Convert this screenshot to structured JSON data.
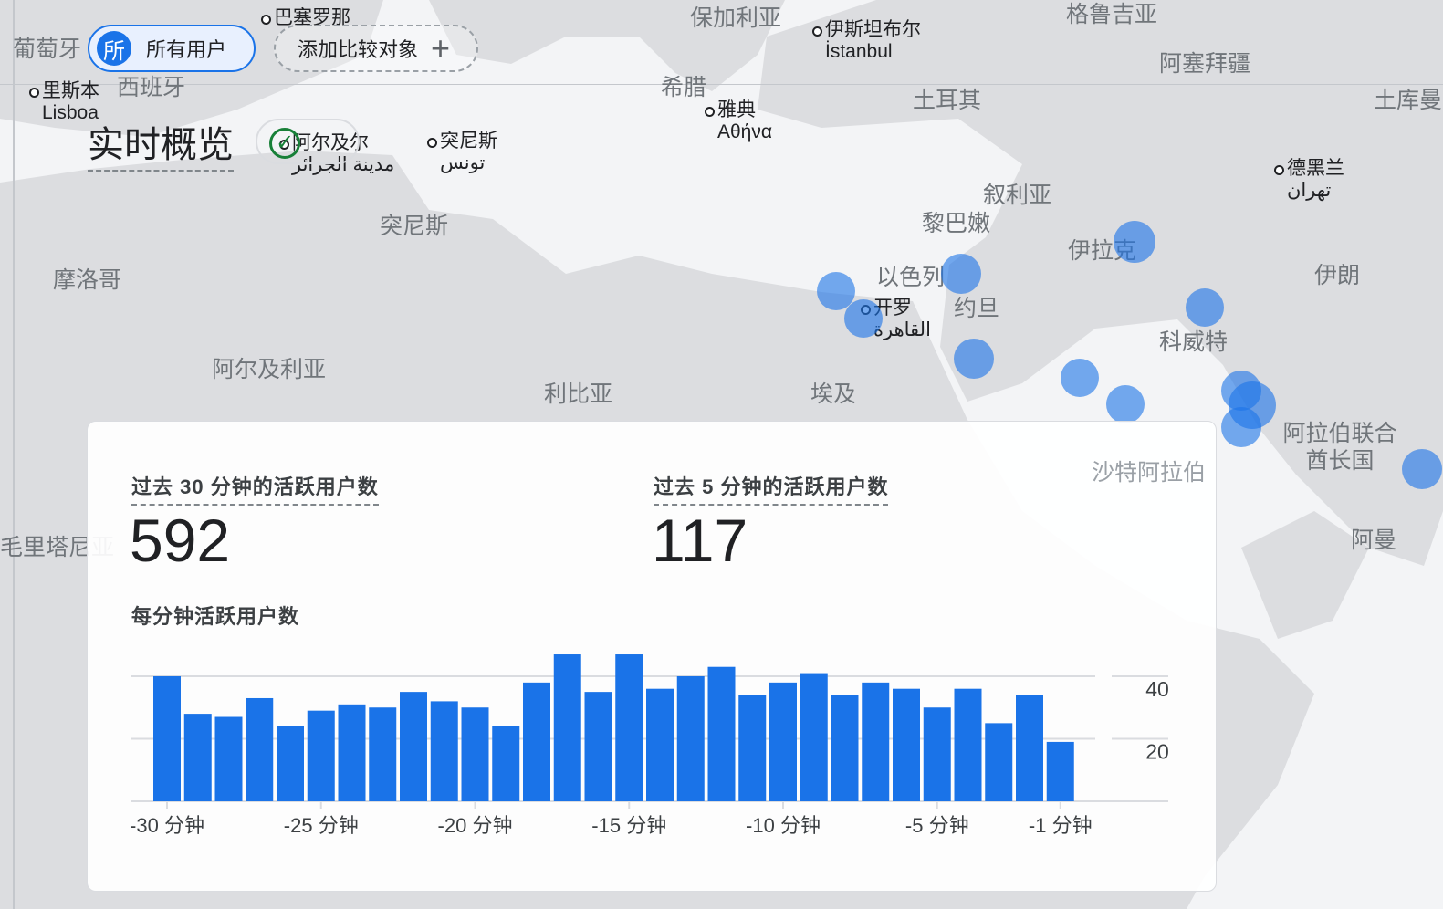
{
  "header": {
    "segment_chip": {
      "avatar": "所",
      "label": "所有用户"
    },
    "add_comparison": "添加比较对象",
    "title": "实时概览"
  },
  "map": {
    "countries": [
      "葡萄牙",
      "西班牙",
      "保加利亚",
      "希腊",
      "土耳其",
      "格鲁吉亚",
      "阿塞拜疆",
      "土库曼",
      "叙利亚",
      "黎巴嫩",
      "以色列",
      "约旦",
      "伊拉克",
      "伊朗",
      "科威特",
      "摩洛哥",
      "突尼斯",
      "阿尔及利亚",
      "利比亚",
      "埃及",
      "沙特阿拉伯",
      "阿拉伯联合酋长国",
      "阿曼",
      "毛里塔尼亚"
    ],
    "cities": [
      {
        "name": "巴塞罗那"
      },
      {
        "name": "里斯本",
        "local": "Lisboa"
      },
      {
        "name": "阿尔及尔",
        "local": "مدينة الجزائر"
      },
      {
        "name": "突尼斯",
        "local": "تونس"
      },
      {
        "name": "雅典",
        "local": "Αθήνα"
      },
      {
        "name": "伊斯坦布尔",
        "local": "İstanbul"
      },
      {
        "name": "德黑兰",
        "local": "تهران"
      },
      {
        "name": "开罗",
        "local": "القاهرة"
      }
    ],
    "bubble_color": "#1a73e8"
  },
  "card": {
    "metric_30": {
      "label": "过去 30 分钟的活跃用户数",
      "value": "592"
    },
    "metric_5": {
      "label": "过去 5 分钟的活跃用户数",
      "value": "117"
    },
    "chart_title": "每分钟活跃用户数"
  },
  "chart_data": {
    "type": "bar",
    "title": "每分钟活跃用户数",
    "values": [
      40,
      28,
      27,
      33,
      24,
      29,
      31,
      30,
      35,
      32,
      30,
      24,
      38,
      47,
      35,
      47,
      36,
      40,
      43,
      34,
      38,
      41,
      34,
      38,
      36,
      30,
      36,
      25,
      34,
      19
    ],
    "x_tick_labels": [
      "-30 分钟",
      "-25 分钟",
      "-20 分钟",
      "-15 分钟",
      "-10 分钟",
      "-5 分钟",
      "-1 分钟"
    ],
    "x_tick_index": [
      0,
      5,
      10,
      15,
      20,
      25,
      29
    ],
    "y_ticks": [
      20,
      40
    ],
    "y_tick_labels": [
      "20",
      "40"
    ],
    "ylim": [
      0,
      40
    ],
    "y_axis_position": "right",
    "grid": true,
    "color": "#1a73e8"
  }
}
